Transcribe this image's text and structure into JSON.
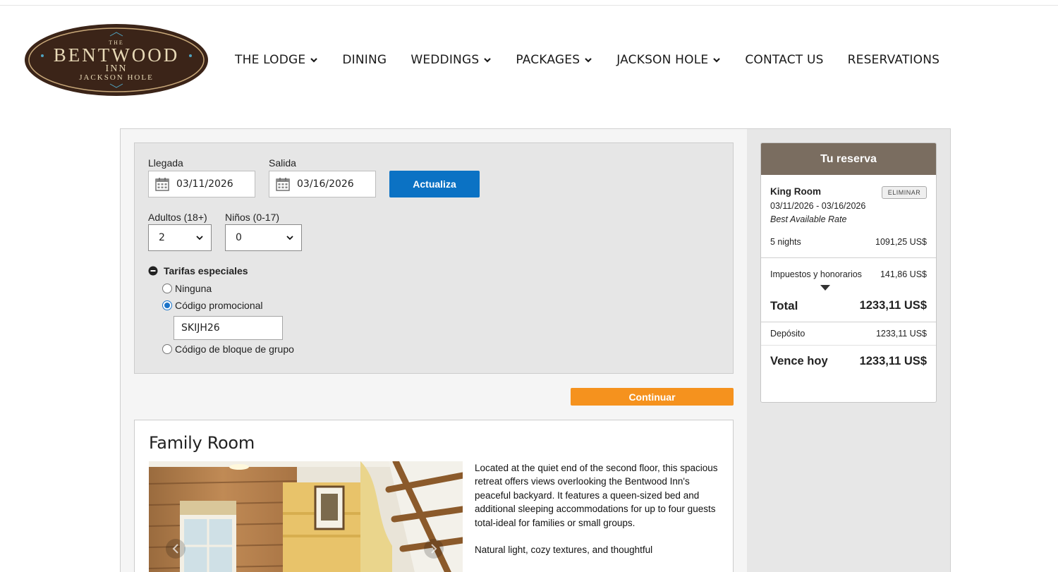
{
  "logo": {
    "the": "THE",
    "name": "BENTWOOD",
    "inn": "INN",
    "location": "JACKSON HOLE",
    "colors": {
      "oval": "#3b2418",
      "ring": "#c9a97a",
      "text": "#e8d9b6",
      "accent": "#4fa3c0"
    }
  },
  "nav": {
    "items": [
      {
        "label": "THE LODGE",
        "has_dropdown": true
      },
      {
        "label": "DINING",
        "has_dropdown": false
      },
      {
        "label": "WEDDINGS",
        "has_dropdown": true
      },
      {
        "label": "PACKAGES",
        "has_dropdown": true
      },
      {
        "label": "JACKSON HOLE",
        "has_dropdown": true
      },
      {
        "label": "CONTACT US",
        "has_dropdown": false
      },
      {
        "label": "RESERVATIONS",
        "has_dropdown": false
      }
    ]
  },
  "search": {
    "arrival_label": "Llegada",
    "arrival_value": "03/11/2026",
    "departure_label": "Salida",
    "departure_value": "03/16/2026",
    "update_button": "Actualiza",
    "adults_label": "Adultos (18+)",
    "adults_value": "2",
    "children_label": "Niños (0-17)",
    "children_value": "0",
    "special_rates_label": "Tarifas especiales",
    "options": [
      {
        "label": "Ninguna",
        "checked": false
      },
      {
        "label": "Código promocional",
        "checked": true
      },
      {
        "label": "Código de bloque de grupo",
        "checked": false
      }
    ],
    "promo_code": "SKIJH26",
    "continue_button": "Continuar",
    "colors": {
      "update": "#0b72c4",
      "continue": "#f5921e"
    }
  },
  "room": {
    "title": "Family Room",
    "description": [
      "Located at the quiet end of the second floor, this spacious retreat offers views overlooking the Bentwood Inn's peaceful backyard. It features a queen-sized bed and additional sleeping accommodations for up to four guests total-ideal for families or small groups.",
      "Natural light, cozy textures, and thoughtful"
    ]
  },
  "summary": {
    "title": "Tu reserva",
    "room_name": "King Room",
    "remove_button": "ELIMINAR",
    "dates": "03/11/2026 - 03/16/2026",
    "rate": "Best Available Rate",
    "nights_label": "5 nights",
    "nights_value": "1091,25 US$",
    "taxes_label": "Impuestos y honorarios",
    "taxes_value": "141,86 US$",
    "total_label": "Total",
    "total_value": "1233,11 US$",
    "deposit_label": "Depósito",
    "deposit_value": "1233,11 US$",
    "due_label": "Vence hoy",
    "due_value": "1233,11 US$",
    "colors": {
      "header": "#7a6d60"
    }
  }
}
